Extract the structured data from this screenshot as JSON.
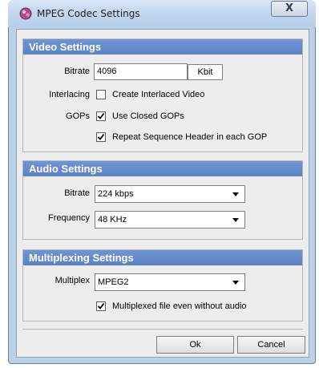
{
  "window": {
    "title": "MPEG Codec Settings",
    "close_glyph": "X",
    "icon": "app-codec-icon"
  },
  "video": {
    "header": "Video Settings",
    "bitrate_label": "Bitrate",
    "bitrate_value": "4096",
    "bitrate_unit": "Kbit",
    "interlacing_label": "Interlacing",
    "interlaced_text": "Create Interlaced Video",
    "interlaced_checked": false,
    "gops_label": "GOPs",
    "closed_gops_text": "Use Closed GOPs",
    "closed_gops_checked": true,
    "repeat_header_text": "Repeat Sequence Header in each GOP",
    "repeat_header_checked": true
  },
  "audio": {
    "header": "Audio Settings",
    "bitrate_label": "Bitrate",
    "bitrate_value": "224 kbps",
    "frequency_label": "Frequency",
    "frequency_value": "48 KHz"
  },
  "multiplexing": {
    "header": "Multiplexing Settings",
    "multiplex_label": "Multiplex",
    "multiplex_value": "MPEG2",
    "without_audio_text": "Multiplexed file even without audio",
    "without_audio_checked": true
  },
  "buttons": {
    "ok": "Ok",
    "cancel": "Cancel"
  },
  "colors": {
    "section_header": "#5b82c4",
    "frame": "#bcd1e8"
  }
}
